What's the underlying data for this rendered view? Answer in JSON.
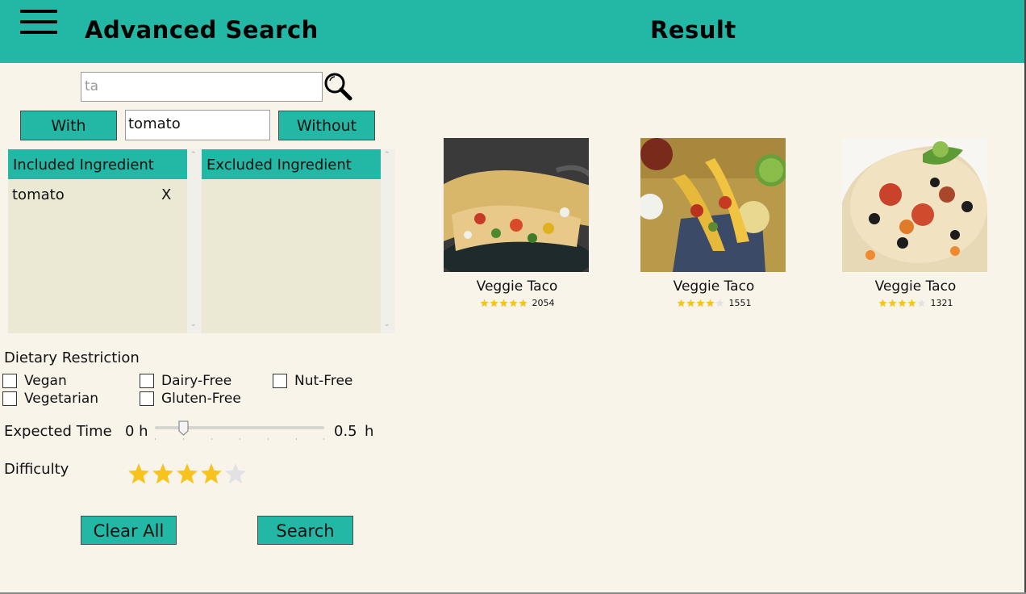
{
  "header": {
    "title": "Advanced Search",
    "result_title": "Result",
    "accent": "#22b8a5"
  },
  "search": {
    "value": "ta"
  },
  "ingredient_filter": {
    "with_label": "With",
    "without_label": "Without",
    "input_value": "tomato"
  },
  "included": {
    "header": "Included Ingredient",
    "items": [
      {
        "name": "tomato",
        "remove": "X"
      }
    ]
  },
  "excluded": {
    "header": "Excluded Ingredient",
    "items": []
  },
  "dietary": {
    "label": "Dietary Restriction",
    "options": [
      {
        "label": "Vegan",
        "checked": false
      },
      {
        "label": "Dairy-Free",
        "checked": false
      },
      {
        "label": "Nut-Free",
        "checked": false
      },
      {
        "label": "Vegetarian",
        "checked": false
      },
      {
        "label": "Gluten-Free",
        "checked": false
      }
    ]
  },
  "time": {
    "label": "Expected Time",
    "min_label": "0 h",
    "value": "0.5",
    "unit": "h",
    "slider_fraction": 0.17
  },
  "difficulty": {
    "label": "Difficulty",
    "rating": 4,
    "max": 5
  },
  "actions": {
    "clear_label": "Clear All",
    "search_label": "Search"
  },
  "results": [
    {
      "title": "Veggie Taco",
      "rating": 5,
      "count": "2054"
    },
    {
      "title": "Veggie Taco",
      "rating": 4,
      "count": "1551"
    },
    {
      "title": "Veggie Taco",
      "rating": 4,
      "count": "1321"
    }
  ]
}
